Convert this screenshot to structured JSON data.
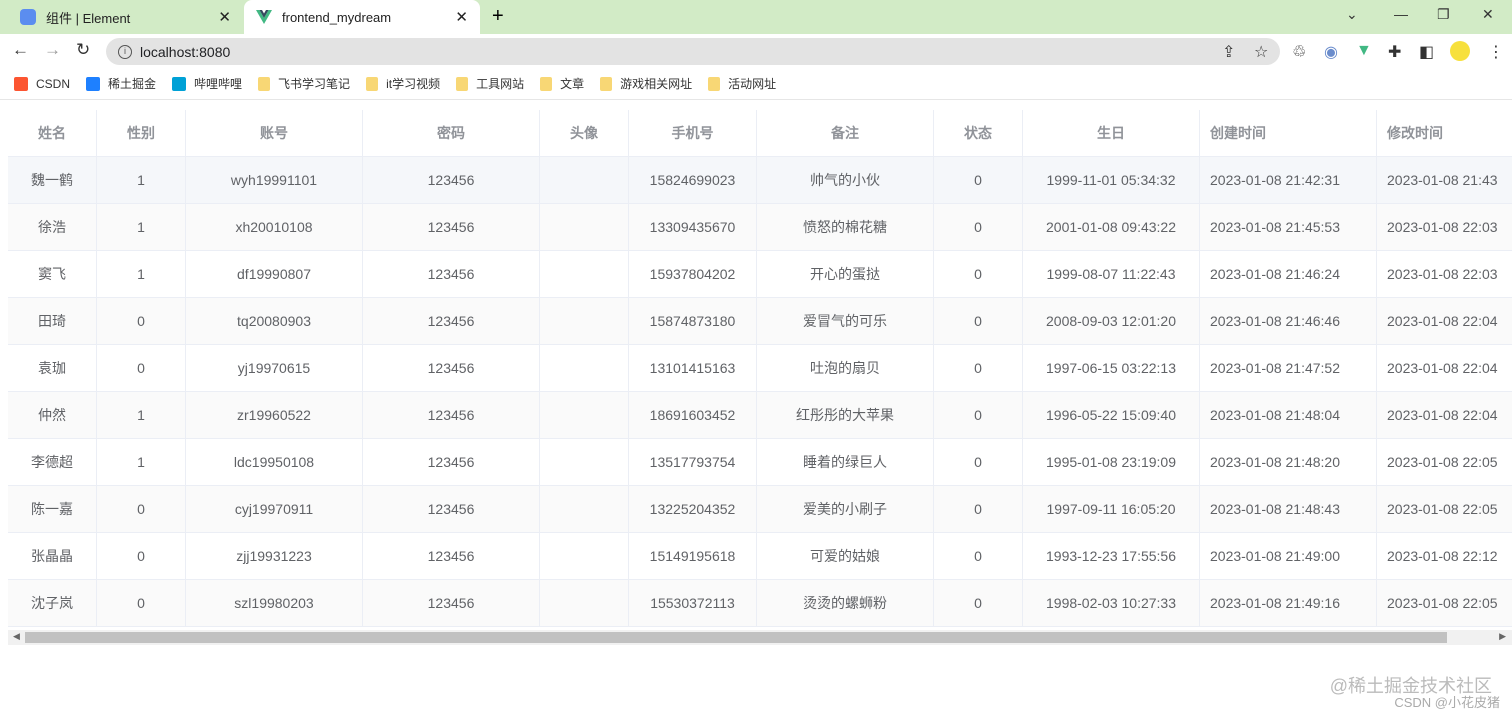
{
  "browser": {
    "tabs": [
      {
        "title": "组件 | Element",
        "icon": "element-logo-icon",
        "active": false
      },
      {
        "title": "frontend_mydream",
        "icon": "vue-logo-icon",
        "active": true
      }
    ],
    "url": "localhost:8080",
    "bookmarks": [
      {
        "label": "CSDN",
        "icon": "csdn-icon"
      },
      {
        "label": "稀土掘金",
        "icon": "juejin-icon"
      },
      {
        "label": "哔哩哔哩",
        "icon": "bilibili-icon"
      },
      {
        "label": "飞书学习笔记",
        "icon": "folder-icon"
      },
      {
        "label": "it学习视频",
        "icon": "folder-icon"
      },
      {
        "label": "工具网站",
        "icon": "folder-icon"
      },
      {
        "label": "文章",
        "icon": "folder-icon"
      },
      {
        "label": "游戏相关网址",
        "icon": "folder-icon"
      },
      {
        "label": "活动网址",
        "icon": "folder-icon"
      }
    ]
  },
  "table": {
    "columns": [
      "姓名",
      "性别",
      "账号",
      "密码",
      "头像",
      "手机号",
      "备注",
      "状态",
      "生日",
      "创建时间",
      "修改时间"
    ],
    "rows": [
      [
        "魏一鹤",
        "1",
        "wyh19991101",
        "123456",
        "",
        "15824699023",
        "帅气的小伙",
        "0",
        "1999-11-01 05:34:32",
        "2023-01-08 21:42:31",
        "2023-01-08 21:43"
      ],
      [
        "徐浩",
        "1",
        "xh20010108",
        "123456",
        "",
        "13309435670",
        "愤怒的棉花糖",
        "0",
        "2001-01-08 09:43:22",
        "2023-01-08 21:45:53",
        "2023-01-08 22:03"
      ],
      [
        "窦飞",
        "1",
        "df19990807",
        "123456",
        "",
        "15937804202",
        "开心的蛋挞",
        "0",
        "1999-08-07 11:22:43",
        "2023-01-08 21:46:24",
        "2023-01-08 22:03"
      ],
      [
        "田琦",
        "0",
        "tq20080903",
        "123456",
        "",
        "15874873180",
        "爱冒气的可乐",
        "0",
        "2008-09-03 12:01:20",
        "2023-01-08 21:46:46",
        "2023-01-08 22:04"
      ],
      [
        "袁珈",
        "0",
        "yj19970615",
        "123456",
        "",
        "13101415163",
        "吐泡的扇贝",
        "0",
        "1997-06-15 03:22:13",
        "2023-01-08 21:47:52",
        "2023-01-08 22:04"
      ],
      [
        "仲然",
        "1",
        "zr19960522",
        "123456",
        "",
        "18691603452",
        "红彤彤的大苹果",
        "0",
        "1996-05-22 15:09:40",
        "2023-01-08 21:48:04",
        "2023-01-08 22:04"
      ],
      [
        "李德超",
        "1",
        "ldc19950108",
        "123456",
        "",
        "13517793754",
        "睡着的绿巨人",
        "0",
        "1995-01-08 23:19:09",
        "2023-01-08 21:48:20",
        "2023-01-08 22:05"
      ],
      [
        "陈一嘉",
        "0",
        "cyj19970911",
        "123456",
        "",
        "13225204352",
        "爱美的小刷子",
        "0",
        "1997-09-11 16:05:20",
        "2023-01-08 21:48:43",
        "2023-01-08 22:05"
      ],
      [
        "张晶晶",
        "0",
        "zjj19931223",
        "123456",
        "",
        "15149195618",
        "可爱的姑娘",
        "0",
        "1993-12-23 17:55:56",
        "2023-01-08 21:49:00",
        "2023-01-08 22:12"
      ],
      [
        "沈子岚",
        "0",
        "szl19980203",
        "123456",
        "",
        "15530372113",
        "烫烫的螺蛳粉",
        "0",
        "1998-02-03 10:27:33",
        "2023-01-08 21:49:16",
        "2023-01-08 22:05"
      ]
    ]
  },
  "watermark": {
    "line1": "@稀土掘金技术社区",
    "line2": "CSDN @小花皮猪"
  }
}
